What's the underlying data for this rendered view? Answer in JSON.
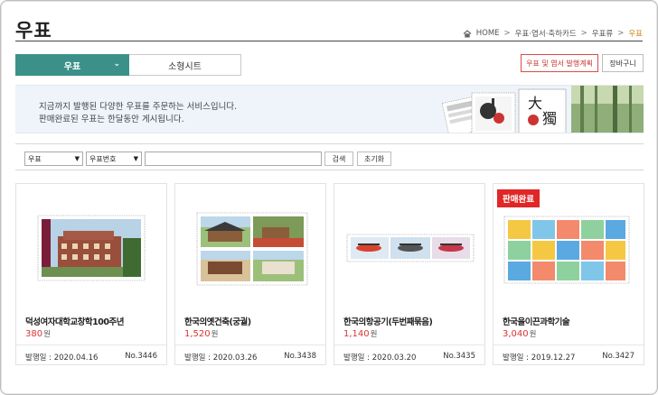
{
  "page": {
    "title": "우표"
  },
  "breadcrumb": {
    "items": [
      "HOME",
      "우표·엽서·축하카드",
      "우표류",
      "우표"
    ]
  },
  "tabs": [
    {
      "label": "우표",
      "active": true
    },
    {
      "label": "소형시트",
      "active": false
    }
  ],
  "actions": {
    "plan_label": "우표 및 엽서 발행계획",
    "cart_label": "장바구니"
  },
  "intro": {
    "line1": "지금까지 발행된 다양한 우표를 주문하는 서비스입니다.",
    "line2": "판매완료된 우표는 한달동안 게시됩니다."
  },
  "search": {
    "category_value": "우표",
    "field_value": "우표번호",
    "keyword_value": "",
    "search_label": "검색",
    "reset_label": "초기화"
  },
  "products": [
    {
      "name": "덕성여자대학교창학100주년",
      "price": "380",
      "currency": "원",
      "date_label": "발행일 : 2020.04.16",
      "number": "No.3446",
      "sold_out": false
    },
    {
      "name": "한국의옛건축(궁궐)",
      "price": "1,520",
      "currency": "원",
      "date_label": "발행일 : 2020.03.26",
      "number": "No.3438",
      "sold_out": false
    },
    {
      "name": "한국의항공기(두번째묶음)",
      "price": "1,140",
      "currency": "원",
      "date_label": "발행일 : 2020.03.20",
      "number": "No.3435",
      "sold_out": false
    },
    {
      "name": "한국을이끈과학기술",
      "price": "3,040",
      "currency": "원",
      "date_label": "발행일 : 2019.12.27",
      "number": "No.3427",
      "sold_out": true,
      "sold_out_label": "판매완료"
    }
  ],
  "colors": {
    "accent": "#3b918a",
    "price": "#dd3333",
    "soldout": "#e02727",
    "breadcrumb_current": "#c98a1b"
  },
  "icons": [
    "home-icon",
    "chevron-down-icon"
  ]
}
